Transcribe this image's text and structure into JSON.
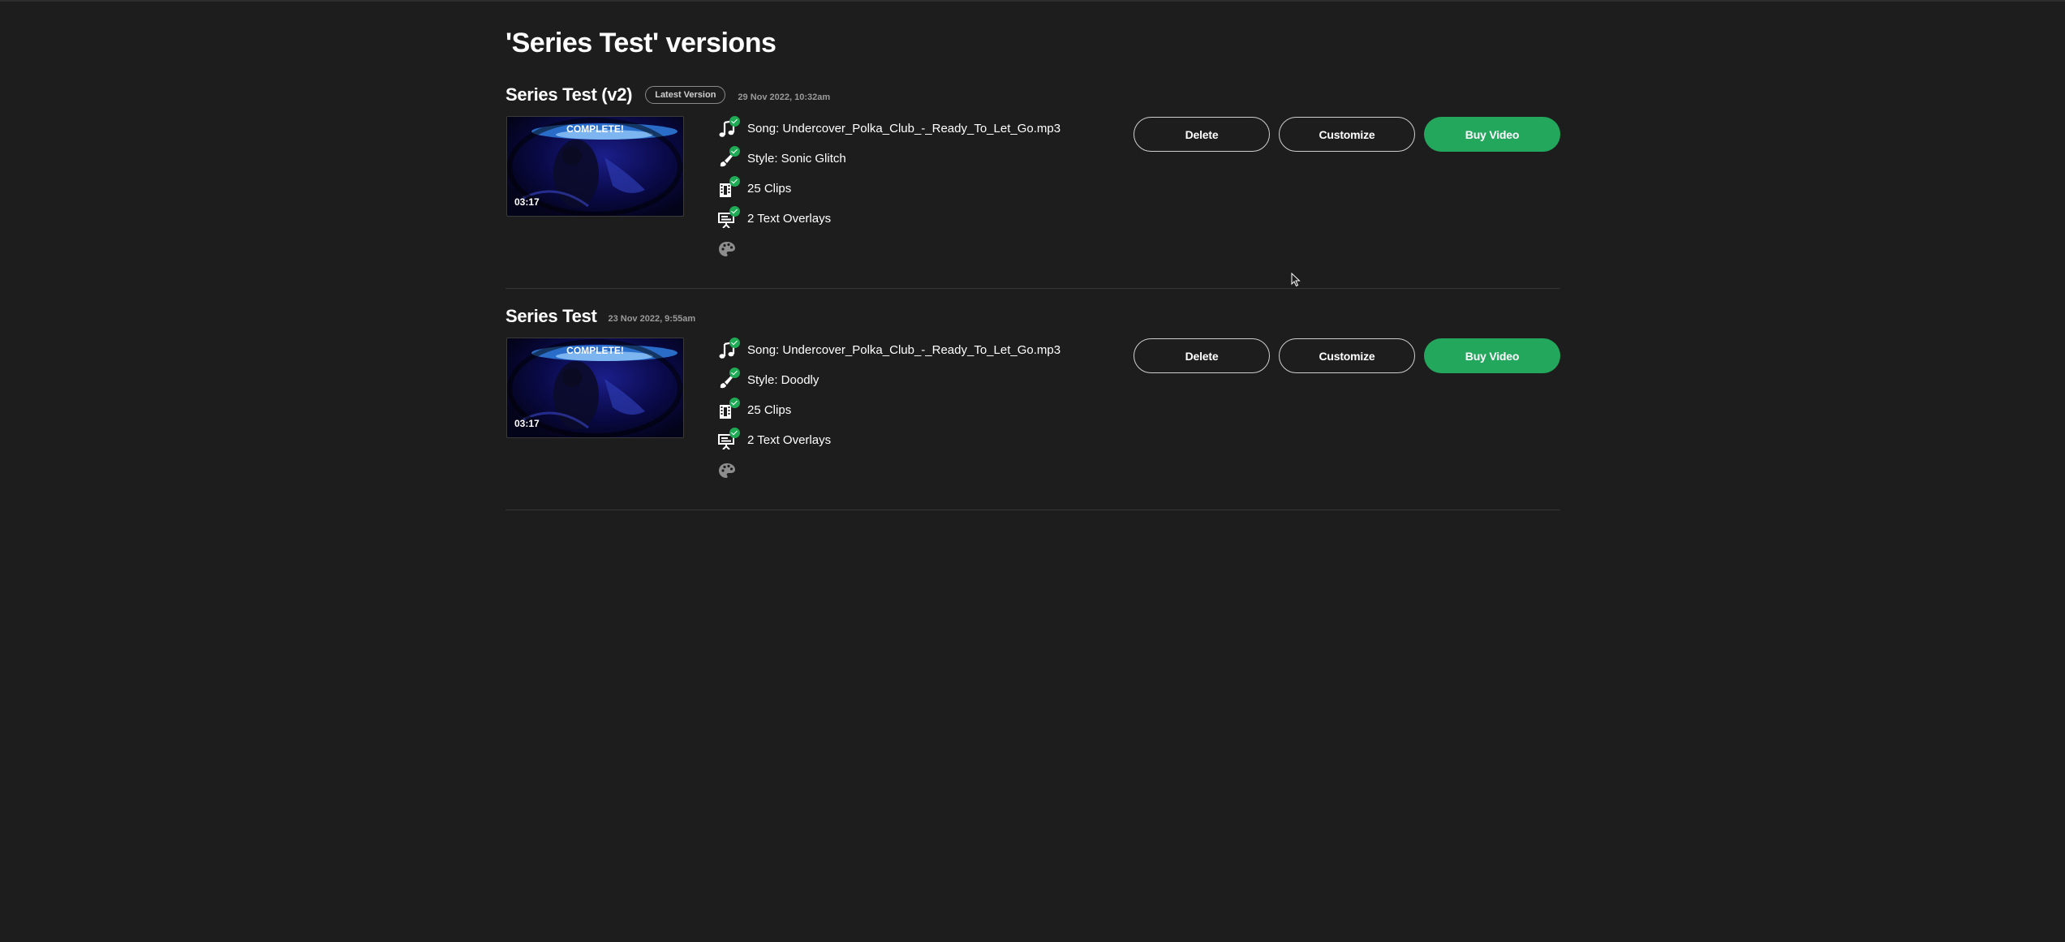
{
  "page": {
    "title": "'Series Test' versions"
  },
  "versions": [
    {
      "name": "Series Test (v2)",
      "badge": "Latest Version",
      "date": "29 Nov 2022, 10:32am",
      "thumbnail": {
        "status": "COMPLETE!",
        "duration": "03:17"
      },
      "details": {
        "song": "Song: Undercover_Polka_Club_-_Ready_To_Let_Go.mp3",
        "style": "Style: Sonic Glitch",
        "clips": "25 Clips",
        "overlays": "2 Text Overlays"
      },
      "actions": {
        "delete": "Delete",
        "customize": "Customize",
        "buy": "Buy Video"
      }
    },
    {
      "name": "Series Test",
      "badge": "",
      "date": "23 Nov 2022, 9:55am",
      "thumbnail": {
        "status": "COMPLETE!",
        "duration": "03:17"
      },
      "details": {
        "song": "Song: Undercover_Polka_Club_-_Ready_To_Let_Go.mp3",
        "style": "Style: Doodly",
        "clips": "25 Clips",
        "overlays": "2 Text Overlays"
      },
      "actions": {
        "delete": "Delete",
        "customize": "Customize",
        "buy": "Buy Video"
      }
    }
  ],
  "icons": {
    "song": "music-note-icon",
    "style": "paintbrush-icon",
    "clips": "film-clips-icon",
    "overlays": "presentation-screen-icon",
    "palette": "palette-icon",
    "check": "check-circle-icon"
  },
  "colors": {
    "background": "#1d1d1d",
    "accent": "#23a75c",
    "check": "#1faa55",
    "divider": "#363636"
  }
}
